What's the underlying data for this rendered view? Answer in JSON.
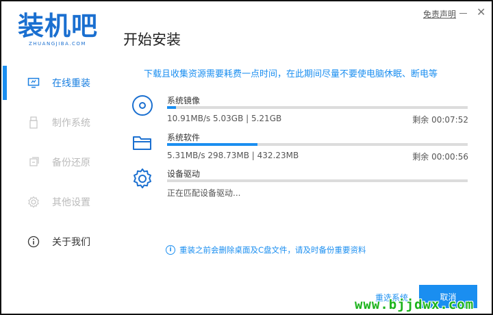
{
  "app": {
    "logo_text": "装机吧",
    "logo_subtext": "ZHUANGJIBA.COM",
    "title": "开始安装",
    "disclaimer": "免责声明",
    "close_glyph": "✕"
  },
  "sidebar": {
    "items": [
      {
        "label": "在线重装",
        "icon": "monitor-icon",
        "state": "active"
      },
      {
        "label": "制作系统",
        "icon": "usb-icon",
        "state": "disabled"
      },
      {
        "label": "备份还原",
        "icon": "backup-icon",
        "state": "disabled"
      },
      {
        "label": "其他设置",
        "icon": "gear-icon",
        "state": "disabled"
      },
      {
        "label": "关于我们",
        "icon": "info-icon",
        "state": "normal"
      }
    ]
  },
  "main": {
    "notice": "下载且收集资源需要耗费一点时间，在此期间尽量不要使电脑休眠、断电等",
    "tasks": [
      {
        "name": "系统镜像",
        "icon": "disc-icon",
        "stats": "10.91MB/s 5.03GB | 5.21GB",
        "remaining": "剩余 00:07:52",
        "progress": 0.03
      },
      {
        "name": "系统软件",
        "icon": "folder-icon",
        "stats": "5.31MB/s 298.73MB | 432.23MB",
        "remaining": "剩余 00:00:56",
        "progress": 0.3
      },
      {
        "name": "设备驱动",
        "icon": "gear-icon",
        "stats": "正在匹配设备驱动...",
        "remaining": "",
        "progress": 0
      }
    ],
    "warning_icon": "i",
    "warning": "重装之前会删除桌面及C盘文件，请及时备份重要资料",
    "reselect_label": "重选系统",
    "cancel_label": "取消",
    "watermark": "www.bjjdwx.com"
  },
  "colors": {
    "accent": "#1a8ef0",
    "watermark": "#1bb31b"
  }
}
